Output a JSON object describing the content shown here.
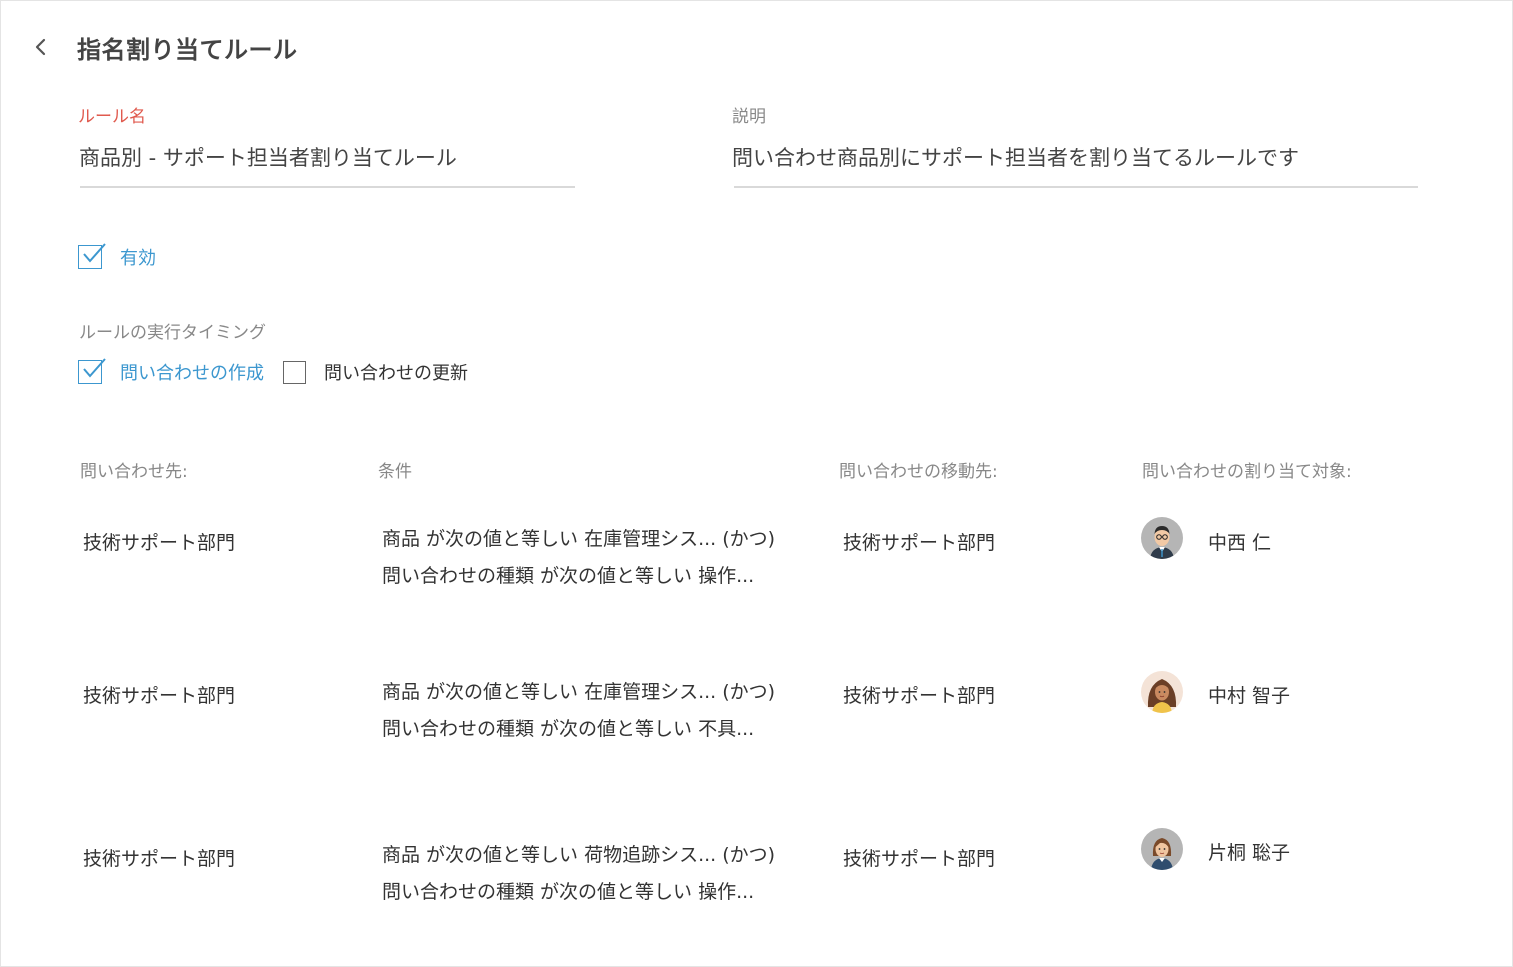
{
  "header": {
    "title": "指名割り当てルール"
  },
  "form": {
    "rule_name_label": "ルール名",
    "rule_name_value": "商品別 - サポート担当者割り当てルール",
    "description_label": "説明",
    "description_value": "問い合わせ商品別にサポート担当者を割り当てるルールです",
    "enabled_label": "有効",
    "enabled": true
  },
  "timing": {
    "label": "ルールの実行タイミング",
    "options": [
      {
        "label": "問い合わせの作成",
        "checked": true
      },
      {
        "label": "問い合わせの更新",
        "checked": false
      }
    ]
  },
  "table": {
    "headers": [
      "問い合わせ先:",
      "条件",
      "問い合わせの移動先:",
      "問い合わせの割り当て対象:"
    ],
    "rows": [
      {
        "source": "技術サポート部門",
        "condition_line1": "商品 が次の値と等しい 在庫管理シス... (かつ)",
        "condition_line2": "問い合わせの種類 が次の値と等しい 操作...",
        "destination": "技術サポート部門",
        "assignee": "中西 仁",
        "avatar": "man-glasses-avatar-icon"
      },
      {
        "source": "技術サポート部門",
        "condition_line1": "商品 が次の値と等しい 在庫管理シス... (かつ)",
        "condition_line2": "問い合わせの種類 が次の値と等しい 不具...",
        "destination": "技術サポート部門",
        "assignee": "中村 智子",
        "avatar": "woman-curly-hair-avatar-icon"
      },
      {
        "source": "技術サポート部門",
        "condition_line1": "商品 が次の値と等しい 荷物追跡シス... (かつ)",
        "condition_line2": "問い合わせの種類 が次の値と等しい 操作...",
        "destination": "技術サポート部門",
        "assignee": "片桐 聡子",
        "avatar": "woman-short-hair-avatar-icon"
      }
    ]
  },
  "colors": {
    "accent": "#3c97cf",
    "required_label": "#e05a4e",
    "muted_text": "#888888"
  }
}
